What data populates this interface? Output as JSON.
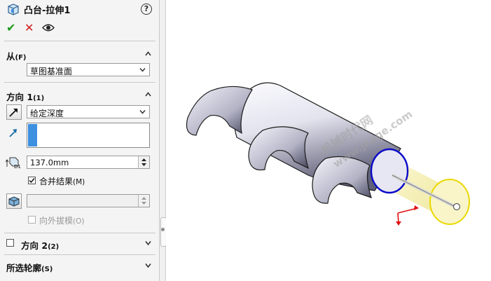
{
  "feature": {
    "title": "凸台-拉伸1",
    "help_glyph": "?"
  },
  "actions": {
    "ok_glyph": "✔",
    "cancel_glyph": "✕"
  },
  "from_section": {
    "title": "从",
    "hotkey": "(F)",
    "start_condition": "草图基准面"
  },
  "direction1": {
    "title": "方向 1",
    "hotkey": "(1)",
    "end_condition": "给定深度",
    "depth": "137.0mm",
    "merge_label": "合并结果",
    "merge_hotkey": "(M)",
    "merge_checked": true,
    "draft_outward_label": "向外拔模",
    "draft_outward_hotkey": "(O)"
  },
  "direction2": {
    "title": "方向 2",
    "hotkey": "(2)",
    "checked": false
  },
  "selected_contours": {
    "title": "所选轮廓",
    "hotkey": "(S)"
  },
  "watermark": {
    "line1": "机械时代网",
    "line2": "www.jxage.com"
  },
  "colors": {
    "accent": "#3d8fe0",
    "ok_green": "#1a9a1a",
    "cancel_red": "#d01c1c",
    "edge_blue": "#0a0ac8",
    "preview_yellow": "#f7f2b4",
    "triad_red": "#e01010"
  }
}
